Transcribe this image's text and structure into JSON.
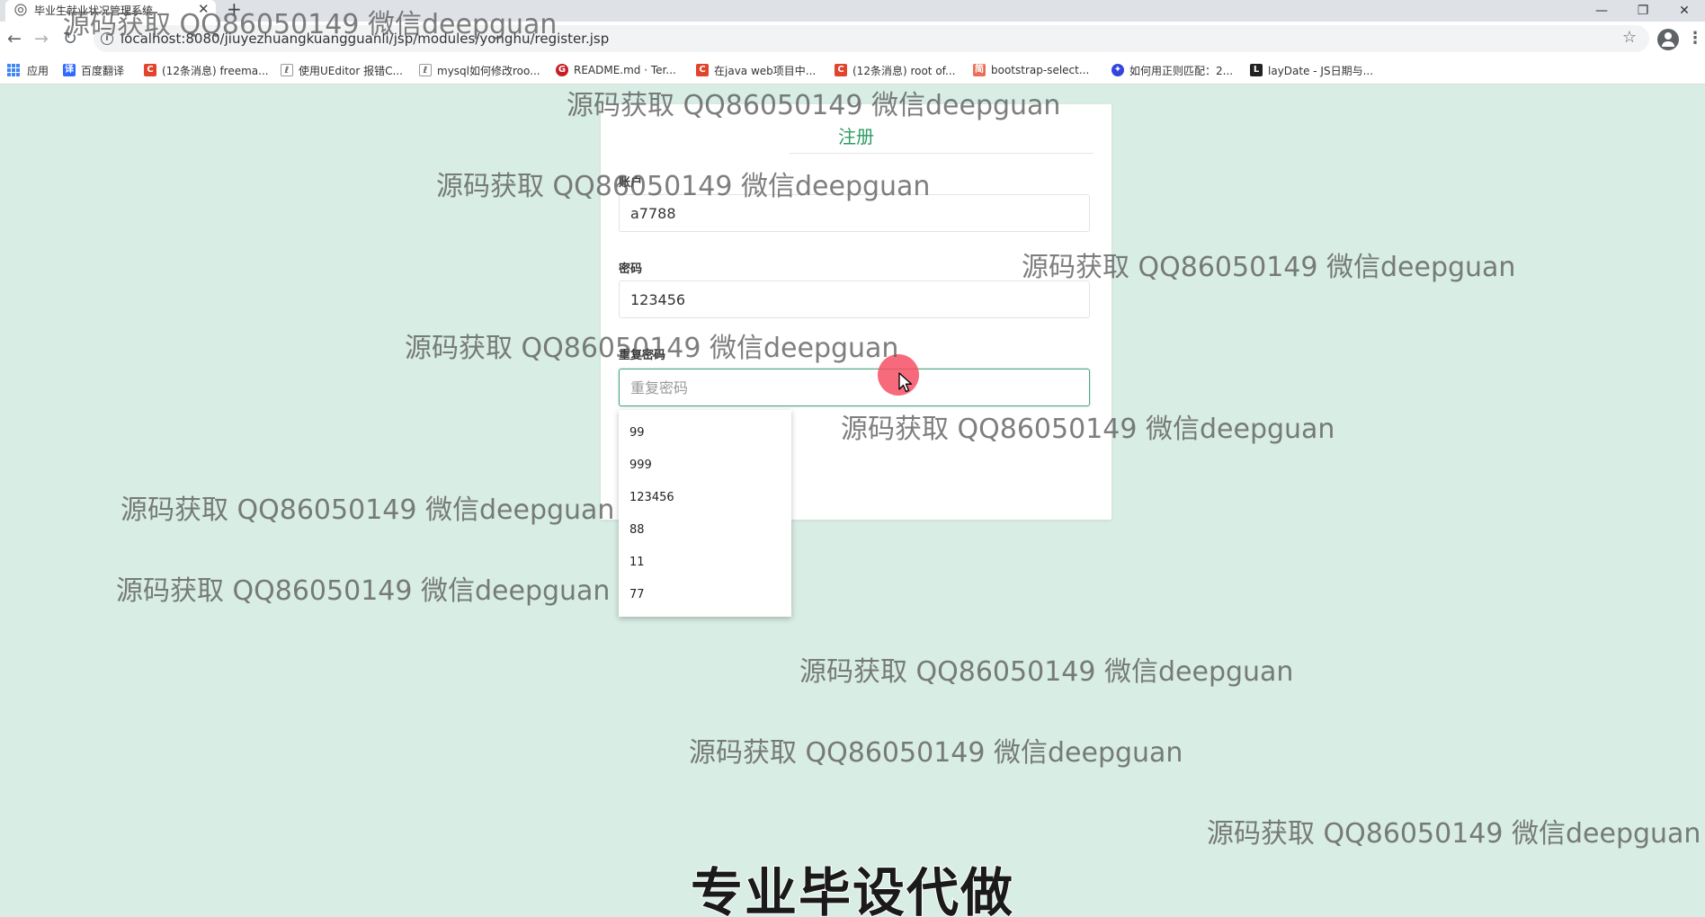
{
  "browser": {
    "tab_title": "毕业生就业状况管理系统",
    "tab_close": "✕",
    "new_tab": "+",
    "url": "localhost:8080/jiuyezhuangkuangguanli/jsp/modules/yonghu/register.jsp",
    "window_controls": {
      "minimize": "—",
      "restore": "❐",
      "close": "✕"
    },
    "nav": {
      "back": "←",
      "forward": "→",
      "reload": "↻"
    },
    "star": "☆",
    "menu": "⋮",
    "info": "i"
  },
  "bookmarks": [
    {
      "label": "应用",
      "icon": "apps-grid-icon",
      "color": "#4285f4"
    },
    {
      "label": "百度翻译",
      "icon": "baidu-translate-icon",
      "color": "#2f6bff"
    },
    {
      "label": "(12条消息) freema...",
      "icon": "csdn-icon",
      "color": "#e1432c"
    },
    {
      "label": "使用UEditor 报错C...",
      "icon": "link-icon",
      "color": "#555555"
    },
    {
      "label": "mysql如何修改roo...",
      "icon": "link-icon",
      "color": "#555555"
    },
    {
      "label": "README.md · Ter...",
      "icon": "gitee-icon",
      "color": "#c71d23"
    },
    {
      "label": "在java web项目中...",
      "icon": "csdn-icon",
      "color": "#e1432c"
    },
    {
      "label": "(12条消息) root of...",
      "icon": "csdn-icon",
      "color": "#e1432c"
    },
    {
      "label": "bootstrap-select...",
      "icon": "jianshu-icon",
      "color": "#ea6f5a"
    },
    {
      "label": "如何用正则匹配：2...",
      "icon": "baidu-paw-icon",
      "color": "#3245df"
    },
    {
      "label": "layDate - JS日期与...",
      "icon": "layui-icon",
      "color": "#222222"
    }
  ],
  "register": {
    "title": "注册",
    "account_label": "账户",
    "account_value": "a7788",
    "password_label": "密码",
    "password_value": "123456",
    "repeat_label": "重复密码",
    "repeat_placeholder": "重复密码"
  },
  "autocomplete": [
    "99",
    "999",
    "123456",
    "88",
    "11",
    "77"
  ],
  "watermark_text": "源码获取 QQ86050149 微信deepguan",
  "banner": "专业毕设代做",
  "colors": {
    "page_bg": "#d8ede4",
    "accent_green": "#2e9c63",
    "click_indicator": "#f55064"
  }
}
